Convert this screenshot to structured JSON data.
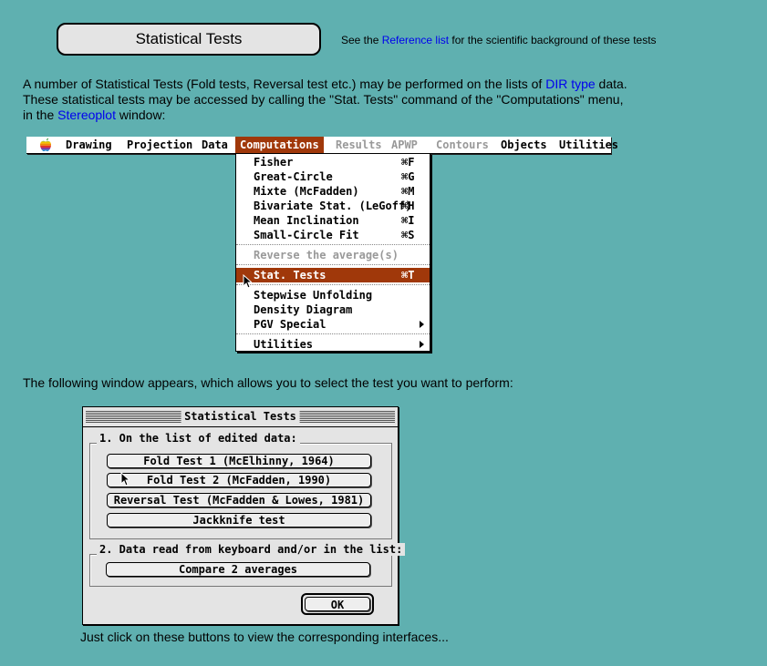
{
  "header": {
    "title": "Statistical Tests",
    "ref_prefix": "See the ",
    "ref_link": "Reference list",
    "ref_suffix": " for the scientific background of these tests"
  },
  "intro": {
    "line1_a": "A number of Statistical Tests (Fold tests, Reversal test etc.) may be performed on the lists of ",
    "line1_link": "DIR type",
    "line1_b": " data.",
    "line2": "These statistical tests may be accessed by calling the \"Stat. Tests\" command of the \"Computations\" menu,",
    "line3_a": "in the ",
    "line3_link": "Stereoplot",
    "line3_b": " window:"
  },
  "menubar": {
    "items": [
      {
        "label": "Drawing"
      },
      {
        "label": "Projection"
      },
      {
        "label": "Data"
      },
      {
        "label": "Computations"
      },
      {
        "label": "Results"
      },
      {
        "label": "APWP"
      },
      {
        "label": "Contours"
      },
      {
        "label": "Objects"
      },
      {
        "label": "Utilities"
      }
    ]
  },
  "menu": {
    "items": [
      {
        "label": "Fisher",
        "shortcut": "⌘F"
      },
      {
        "label": "Great-Circle",
        "shortcut": "⌘G"
      },
      {
        "label": "Mixte (McFadden)",
        "shortcut": "⌘M"
      },
      {
        "label": "Bivariate Stat. (LeGoff)",
        "shortcut": "⌘H"
      },
      {
        "label": "Mean Inclination",
        "shortcut": "⌘I"
      },
      {
        "label": "Small-Circle Fit",
        "shortcut": "⌘S"
      },
      {
        "label": "Reverse the average(s)",
        "shortcut": ""
      },
      {
        "label": "Stat. Tests",
        "shortcut": "⌘T"
      },
      {
        "label": "Stepwise Unfolding",
        "shortcut": ""
      },
      {
        "label": "Density Diagram",
        "shortcut": ""
      },
      {
        "label": "PGV Special",
        "shortcut": ""
      },
      {
        "label": "Utilities",
        "shortcut": ""
      }
    ]
  },
  "follow_text": "The following window appears, which allows you to select the test you want to perform:",
  "dialog": {
    "title": "Statistical Tests",
    "group1_label": "1. On the list of edited data:",
    "group1_buttons": [
      "Fold Test 1 (McElhinny, 1964)",
      "Fold Test 2 (McFadden, 1990)",
      "Reversal Test (McFadden & Lowes, 1981)",
      "Jackknife test"
    ],
    "group2_label": "2. Data read from keyboard and/or in the list:",
    "group2_buttons": [
      "Compare 2 averages"
    ],
    "ok_label": "OK"
  },
  "footer_text": "Just click on these buttons to view the corresponding interfaces...",
  "colors": {
    "background": "#5fb0b0",
    "menu_highlight": "#a0380a",
    "link": "#0000ee"
  }
}
